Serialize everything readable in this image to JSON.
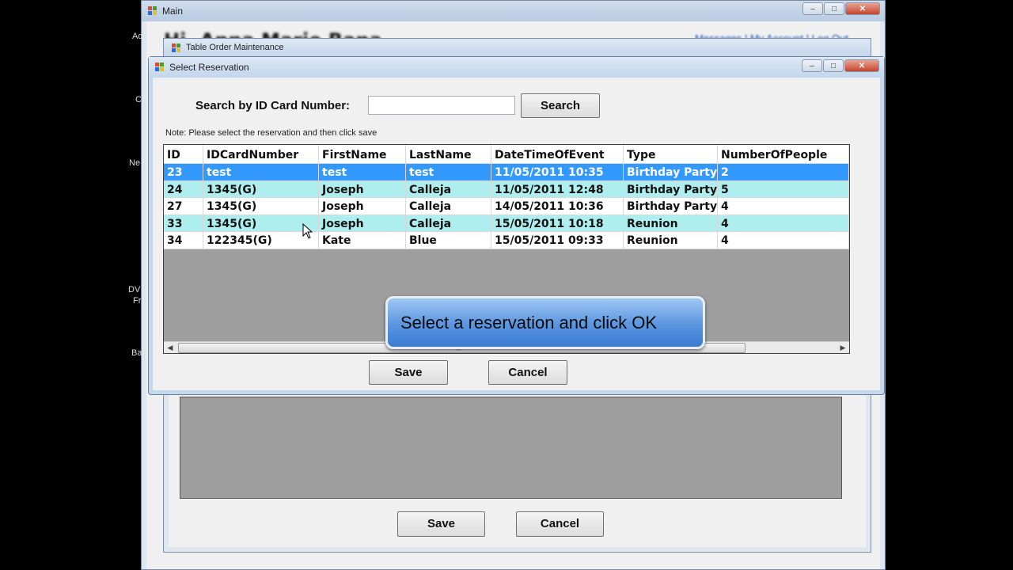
{
  "main_window": {
    "title": "Main",
    "greeting": "Hi, Anna Marie Rapa",
    "links": "Messages | My Account | Log Out",
    "side_labels": [
      "Ad",
      "C",
      "Ne",
      "DV",
      "Fr",
      "Ba"
    ]
  },
  "table_order_window": {
    "title": "Table Order Maintenance",
    "save_label": "Save",
    "cancel_label": "Cancel"
  },
  "select_reservation": {
    "title": "Select Reservation",
    "search_label": "Search by ID Card Number:",
    "search_value": "",
    "search_button": "Search",
    "note": "Note: Please select the reservation and then click save",
    "columns": [
      "ID",
      "IDCardNumber",
      "FirstName",
      "LastName",
      "DateTimeOfEvent",
      "Type",
      "NumberOfPeople"
    ],
    "rows": [
      [
        "23",
        "test",
        "test",
        "test",
        "11/05/2011 10:35",
        "Birthday Party",
        "2"
      ],
      [
        "24",
        "1345(G)",
        "Joseph",
        "Calleja",
        "11/05/2011 12:48",
        "Birthday Party",
        "5"
      ],
      [
        "27",
        "1345(G)",
        "Joseph",
        "Calleja",
        "14/05/2011 10:36",
        "Birthday Party",
        "4"
      ],
      [
        "33",
        "1345(G)",
        "Joseph",
        "Calleja",
        "15/05/2011 10:18",
        "Reunion",
        "4"
      ],
      [
        "34",
        "122345(G)",
        "Kate",
        "Blue",
        "15/05/2011 09:33",
        "Reunion",
        "4"
      ]
    ],
    "selected_row_index": 0,
    "save_label": "Save",
    "cancel_label": "Cancel"
  },
  "tooltip": {
    "text": "Select a reservation and click OK"
  },
  "colors": {
    "selected_row": "#3399ff",
    "alt_row": "#afeeee",
    "grid_background": "#9e9e9e"
  }
}
